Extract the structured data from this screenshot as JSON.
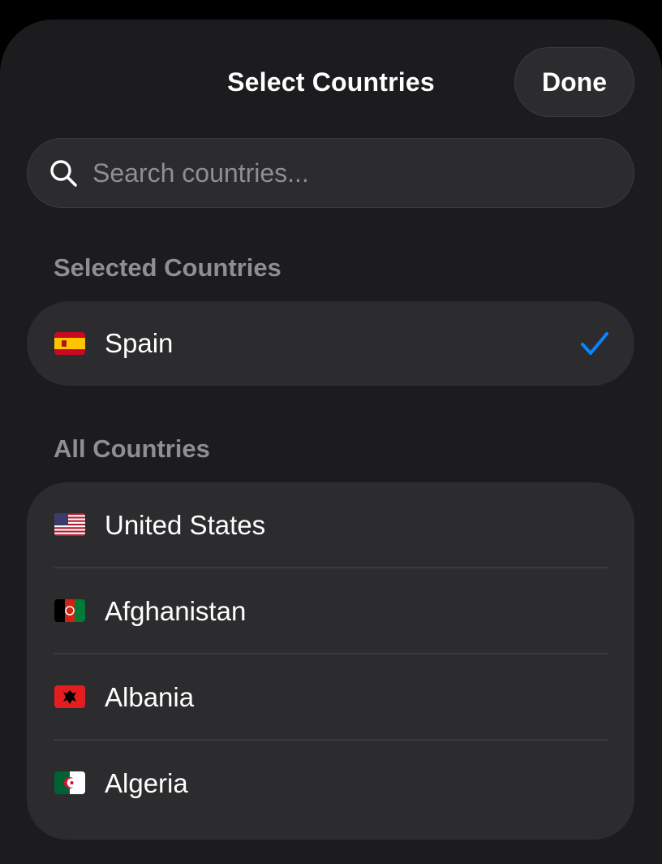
{
  "header": {
    "title": "Select Countries",
    "done_label": "Done"
  },
  "search": {
    "placeholder": "Search countries...",
    "value": "",
    "icon": "search-icon"
  },
  "selected_section": {
    "label": "Selected Countries",
    "items": [
      {
        "name": "Spain",
        "flag": "spain-flag",
        "selected": true
      }
    ]
  },
  "all_section": {
    "label": "All Countries",
    "items": [
      {
        "name": "United States",
        "flag": "united-states-flag"
      },
      {
        "name": "Afghanistan",
        "flag": "afghanistan-flag"
      },
      {
        "name": "Albania",
        "flag": "albania-flag"
      },
      {
        "name": "Algeria",
        "flag": "algeria-flag"
      }
    ]
  },
  "colors": {
    "background": "#1c1c1e",
    "surface": "#2c2c2e",
    "secondary_text": "#8e8e93",
    "accent": "#0a84ff"
  }
}
